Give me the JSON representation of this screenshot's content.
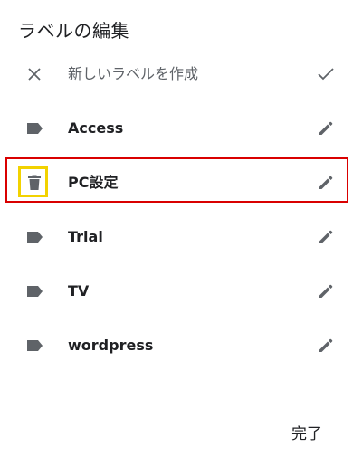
{
  "dialog": {
    "title": "ラベルの編集",
    "new_label_placeholder": "新しいラベルを作成",
    "labels": [
      {
        "name": "Access"
      },
      {
        "name": "PC設定"
      },
      {
        "name": "Trial"
      },
      {
        "name": "TV"
      },
      {
        "name": "wordpress"
      }
    ],
    "done_label": "完了"
  },
  "icons": {
    "close": "close-icon",
    "check": "check-icon",
    "label": "label-icon",
    "trash": "trash-icon",
    "edit": "pencil-icon"
  },
  "colors": {
    "icon_gray": "#5f6368",
    "highlight_red": "#d90000",
    "highlight_yellow": "#f2d200"
  }
}
